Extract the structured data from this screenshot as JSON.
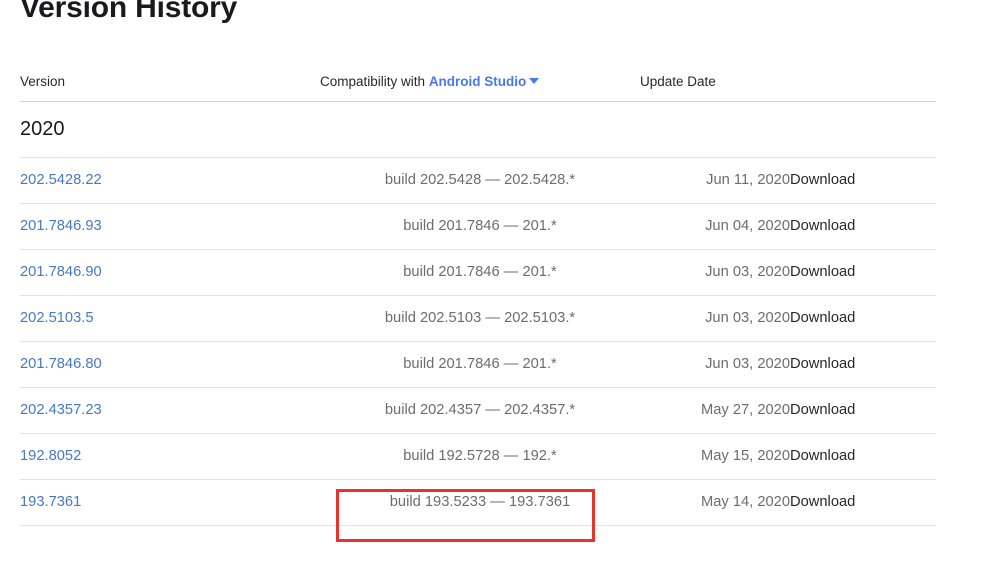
{
  "page": {
    "title": "Version History"
  },
  "table": {
    "headers": {
      "version": "Version",
      "compatibility_prefix": "Compatibility with",
      "compatibility_link": "Android Studio",
      "compatibility_caret": "chevron-down-icon",
      "update_date": "Update Date",
      "download": ""
    },
    "groups": [
      {
        "year": "2020",
        "rows": [
          {
            "version": "202.5428.22",
            "compatibility": "build 202.5428 — 202.5428.*",
            "date": "Jun 11, 2020",
            "download": "Download"
          },
          {
            "version": "201.7846.93",
            "compatibility": "build 201.7846 — 201.*",
            "date": "Jun 04, 2020",
            "download": "Download"
          },
          {
            "version": "201.7846.90",
            "compatibility": "build 201.7846 — 201.*",
            "date": "Jun 03, 2020",
            "download": "Download"
          },
          {
            "version": "202.5103.5",
            "compatibility": "build 202.5103 — 202.5103.*",
            "date": "Jun 03, 2020",
            "download": "Download"
          },
          {
            "version": "201.7846.80",
            "compatibility": "build 201.7846 — 201.*",
            "date": "Jun 03, 2020",
            "download": "Download"
          },
          {
            "version": "202.4357.23",
            "compatibility": "build 202.4357 — 202.4357.*",
            "date": "May 27, 2020",
            "download": "Download"
          },
          {
            "version": "192.8052",
            "compatibility": "build 192.5728 — 192.*",
            "date": "May 15, 2020",
            "download": "Download"
          },
          {
            "version": "193.7361",
            "compatibility": "build 193.5233 — 193.7361",
            "date": "May 14, 2020",
            "download": "Download"
          }
        ]
      }
    ]
  },
  "annotation": {
    "highlight_color": "#e8322e",
    "target_text": "build 193.5233 — 193.7361"
  },
  "colors": {
    "link_blue": "#4878c8",
    "header_link_blue": "#4878f0",
    "text_dark": "#27282c",
    "text_muted": "#6d6d6d",
    "border": "#e3e3e3",
    "header_border": "#d4d4d4",
    "background": "#ffffff"
  }
}
